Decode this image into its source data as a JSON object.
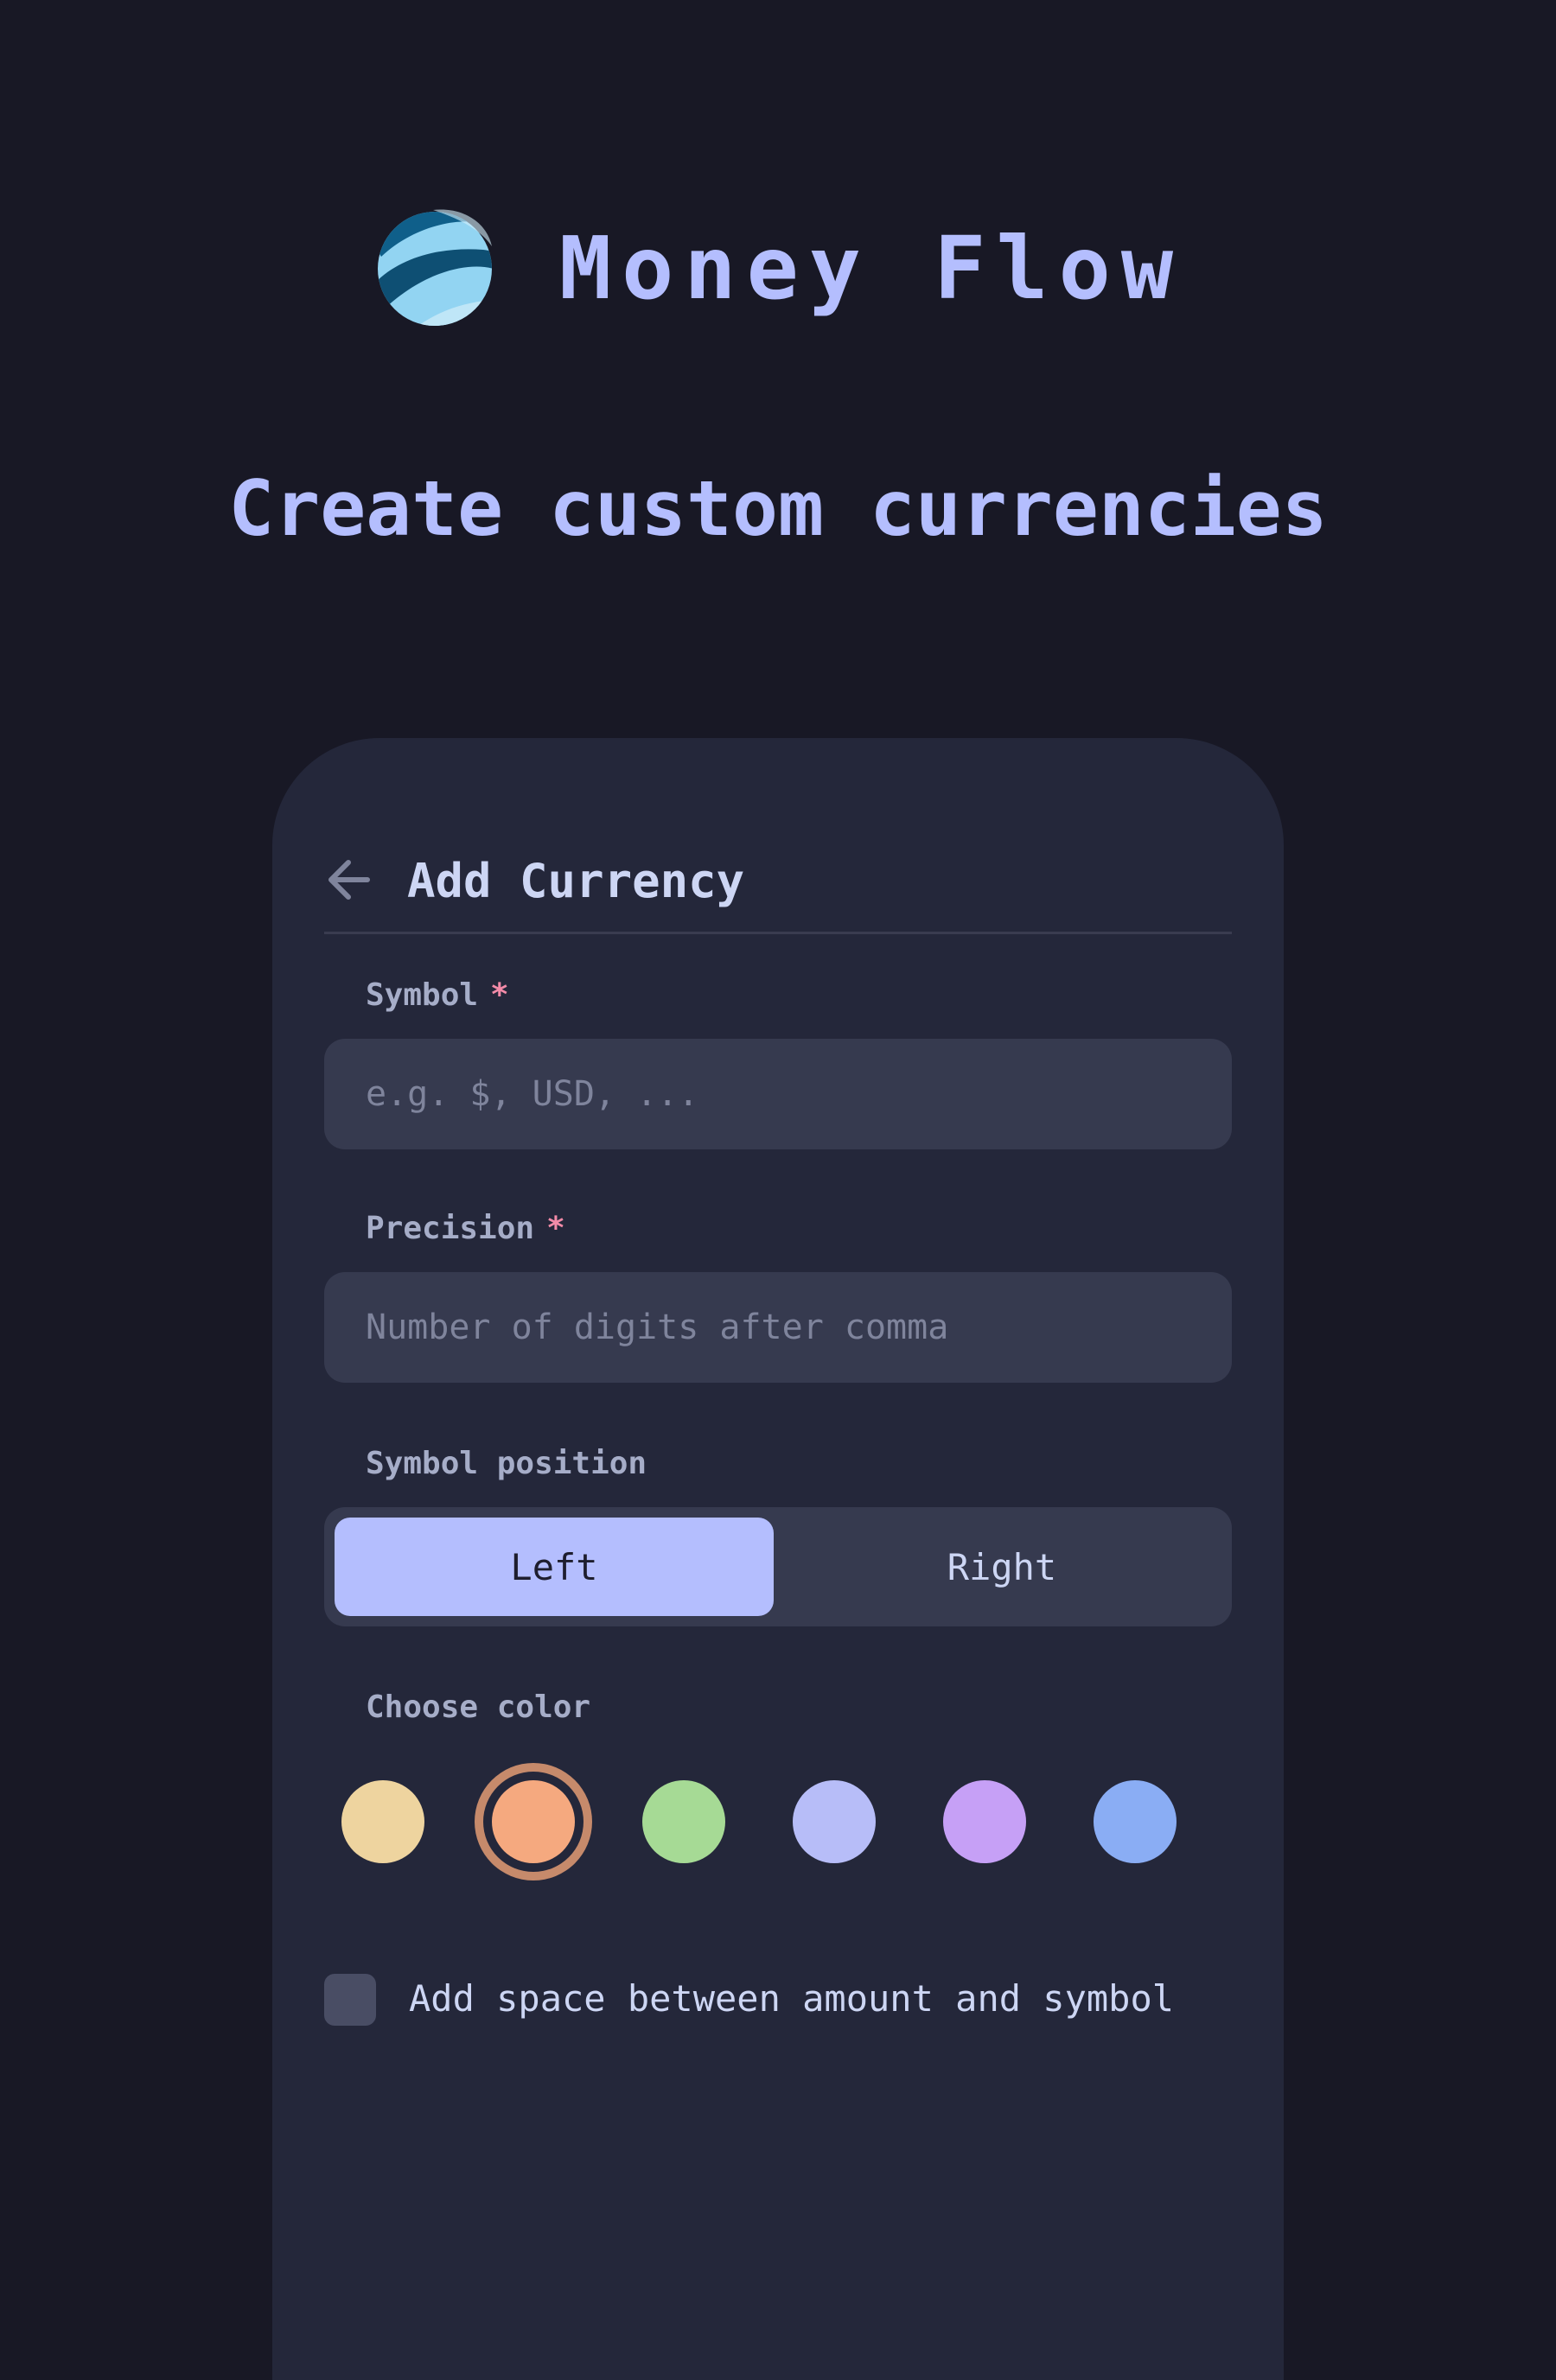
{
  "app": {
    "name": "Money Flow",
    "logo_icon": "money-flow-logo-icon",
    "tagline": "Create custom currencies"
  },
  "screen": {
    "title": "Add Currency",
    "back_icon": "arrow-left-icon"
  },
  "form": {
    "symbol": {
      "label": "Symbol",
      "required_mark": "*",
      "placeholder": "e.g. $, USD, ...",
      "value": ""
    },
    "precision": {
      "label": "Precision",
      "required_mark": "*",
      "placeholder": "Number of digits after comma",
      "value": ""
    },
    "symbol_position": {
      "label": "Symbol position",
      "options": [
        "Left",
        "Right"
      ],
      "selected": "Left"
    },
    "color": {
      "label": "Choose color",
      "swatches": [
        {
          "name": "yellow",
          "hex": "#eed49f"
        },
        {
          "name": "peach",
          "hex": "#f5a97f"
        },
        {
          "name": "green",
          "hex": "#a6da95"
        },
        {
          "name": "lavender",
          "hex": "#b7bdf8"
        },
        {
          "name": "mauve",
          "hex": "#c6a0f6"
        },
        {
          "name": "blue",
          "hex": "#8aadf4"
        }
      ],
      "selected": "peach"
    },
    "space_toggle": {
      "label": "Add space between amount and symbol",
      "checked": false
    }
  },
  "colors": {
    "background": "#181825",
    "card": "#24273a",
    "input": "#363a4f",
    "accent": "#b4befe",
    "required": "#f38ba8",
    "selected_ring": "#c68a6b"
  }
}
